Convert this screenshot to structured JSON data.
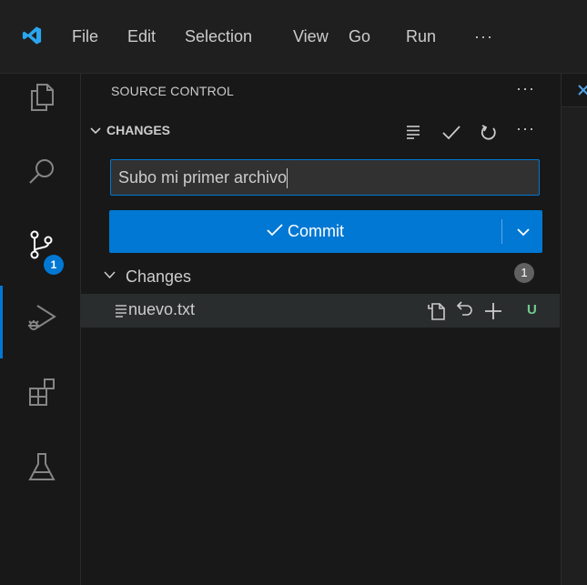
{
  "menu": {
    "items": [
      "File",
      "Edit",
      "Selection",
      "View",
      "Go",
      "Run",
      "···"
    ]
  },
  "activity": {
    "icons": [
      "explorer-icon",
      "search-icon",
      "source-control-icon",
      "run-debug-icon",
      "extensions-icon",
      "testing-icon"
    ],
    "source_control_badge": "1"
  },
  "sidebar": {
    "title": "SOURCE CONTROL",
    "more": "···",
    "section_title": "CHANGES",
    "section_more": "···",
    "commit_message": "Subo mi primer archivo",
    "commit_button": "Commit",
    "changes_group": "Changes",
    "changes_count": "1",
    "files": [
      {
        "name": "nuevo.txt",
        "status": "U"
      }
    ]
  },
  "colors": {
    "accent": "#0078d4",
    "untracked": "#73c991",
    "background": "#181818"
  }
}
